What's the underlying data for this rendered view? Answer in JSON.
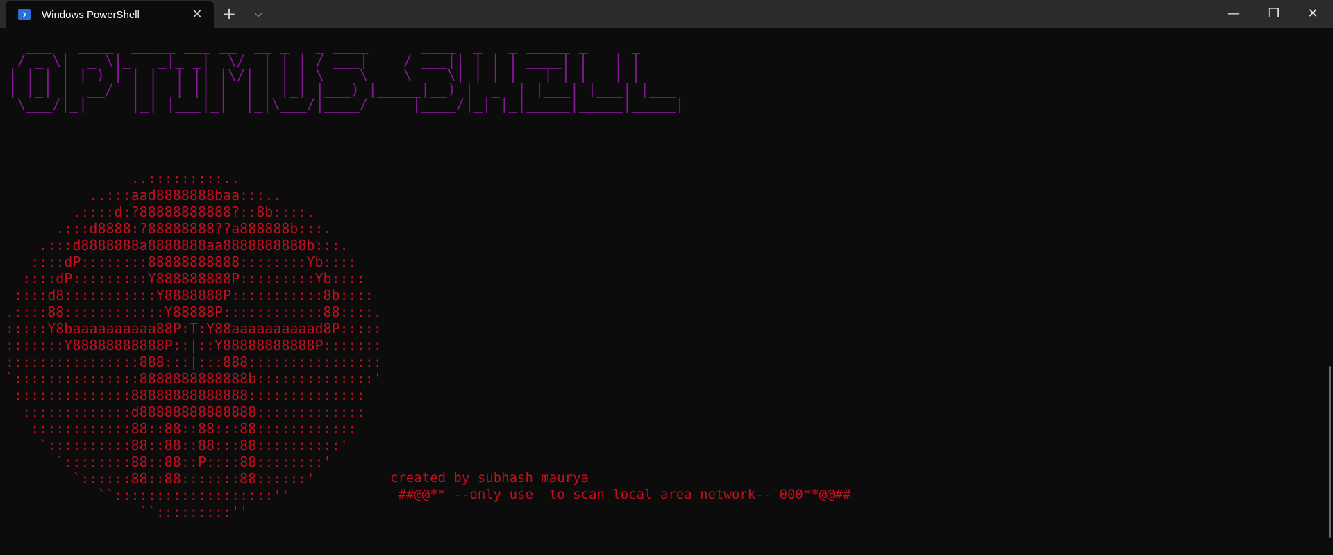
{
  "titlebar": {
    "tab_title": "Windows PowerShell",
    "close_tab": "✕",
    "new_tab": "+",
    "dropdown": "⌵",
    "minimize": "—",
    "maximize": "❐",
    "close": "✕"
  },
  "terminal": {
    "banner": "  ___   ____  _____ ___ __  __ _   _ ____      ____  _   _ _____ _     _\n / _ \\|  _ \\|_   _|_ _|  \\/  | | | / ___|    / ___|| | | | ____| |   | |\n| | | | |_) | | |  | || |\\/| | | | \\___ \\____\\___ \\| |_| |  _| | |   | |\n| |_| |  __/  | |  | || |  | | |_| |___) |_____|__) |  _  | |___| |___| |___\n \\___/|_|     |_| |___|_|  |_|\\___/|____/     |____/|_| |_|_____|_____|_____|",
    "logo": "               ..:::::::::..\n          ..:::aad8888888baa:::..\n        .::::d:?88888888888?::8b::::.\n      .:::d8888:?88888888??a888888b:::.\n    .:::d8888888a8888888aa8888888888b:::.\n   ::::dP::::::::88888888888::::::::Yb::::\n  ::::dP:::::::::Y888888888P:::::::::Yb::::\n ::::d8:::::::::::Y8888888P:::::::::::8b::::\n.::::88::::::::::::Y88888P::::::::::::88::::.\n:::::Y8baaaaaaaaaa88P:T:Y88aaaaaaaaaad8P:::::\n:::::::Y88888888888P::|::Y88888888888P:::::::\n::::::::::::::::888:::|:::888::::::::::::::::\n`:::::::::::::::8888888888888b::::::::::::::'\n ::::::::::::::88888888888888::::::::::::::\n  :::::::::::::d88888888888888:::::::::::::\n   ::::::::::::88::88::88:::88::::::::::::\n    `::::::::::88::88::88:::88::::::::::'\n      `::::::::88::88::P::::88::::::::'\n        `::::::88::88:::::::88::::::'\n           ``:::::::::::::::::::''\n                ``:::::::::''",
    "credit": "created by subhash maurya\n ##@@** --only use  to scan local area network-- 000**@@##"
  },
  "colors": {
    "background": "#0c0c0c",
    "titlebar": "#2b2b2b",
    "banner": "#881798",
    "logo": "#c50f1f"
  }
}
